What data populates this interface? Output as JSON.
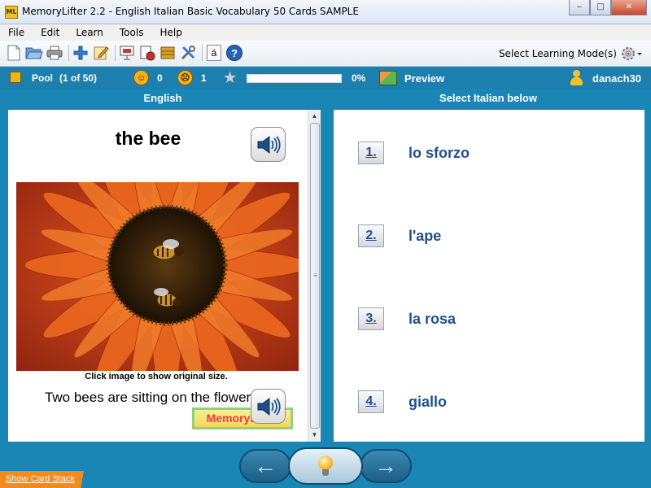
{
  "window": {
    "app_icon_text": "ML",
    "title": "MemoryLifter 2.2 - English Italian Basic Vocabulary 50 Cards SAMPLE",
    "minimize": "‒",
    "maximize": "□",
    "close": "✕"
  },
  "menu": [
    "File",
    "Edit",
    "Learn",
    "Tools",
    "Help"
  ],
  "toolbar": {
    "icons": [
      "new-file-icon",
      "open-folder-icon",
      "print-icon",
      "add-card-icon",
      "edit-icon",
      "presentation-icon",
      "print-cards-icon",
      "box-icon",
      "settings-tools-icon",
      "special-char-icon",
      "help-icon"
    ],
    "special_char": "á",
    "help": "?",
    "learning_mode_label": "Select Learning Mode(s)"
  },
  "status": {
    "pool_label": "Pool",
    "pool_count": "(1 of 50)",
    "known_count": "0",
    "unknown_count": "1",
    "progress_percent_text": "0%",
    "progress_fraction": 0.0,
    "preview_label": "Preview",
    "username": "danach30"
  },
  "columns": {
    "left_header": "English",
    "right_header": "Select Italian below"
  },
  "question": {
    "word": "the bee",
    "image_caption": "Click image to show original size.",
    "example_sentence": "Two bees are sitting on the flower.",
    "logo_text": "MemoryLifter"
  },
  "answers": [
    {
      "number": "1.",
      "text": "lo sforzo"
    },
    {
      "number": "2.",
      "text": "l'ape"
    },
    {
      "number": "3.",
      "text": "la rosa"
    },
    {
      "number": "4.",
      "text": "giallo"
    }
  ],
  "nav": {
    "back_arrow": "←",
    "forward_arrow": "→"
  },
  "bottom": {
    "card_stack_link": "Show Card Stack"
  },
  "colors": {
    "accent": "#1a86b6",
    "answer_text": "#1f4f8f",
    "card_stack_tab": "#f28a1d"
  }
}
